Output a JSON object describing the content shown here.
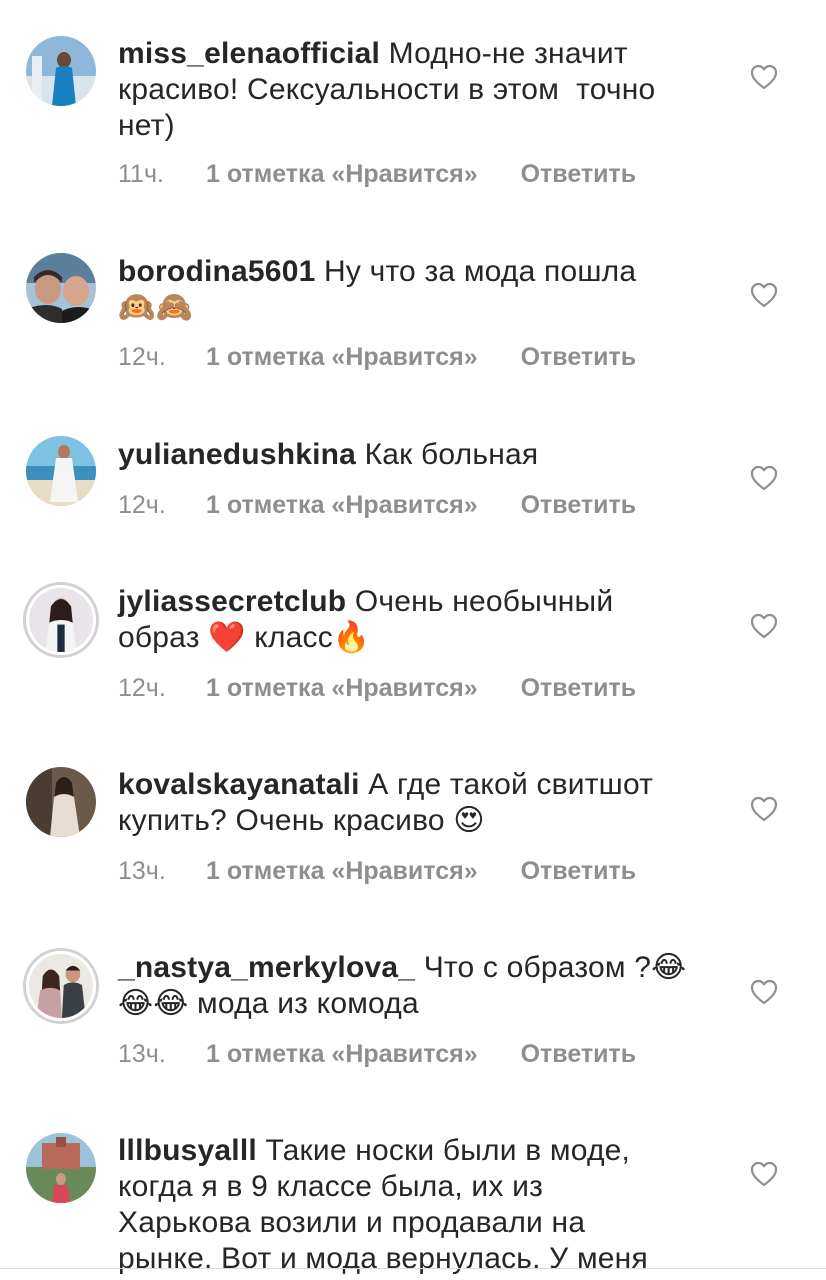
{
  "comments": [
    {
      "username": "miss_elenaofficial",
      "text": "Модно-не значит\nкрасиво! Сексуальности в этом  точно\nнет)",
      "time": "11ч.",
      "likes": "1 отметка «Нравится»",
      "reply": "Ответить"
    },
    {
      "username": "borodina5601",
      "text": "Ну что за мода пошла\n🙉🙈",
      "time": "12ч.",
      "likes": "1 отметка «Нравится»",
      "reply": "Ответить"
    },
    {
      "username": "yulianedushkina",
      "text": "Как больная",
      "time": "12ч.",
      "likes": "1 отметка «Нравится»",
      "reply": "Ответить"
    },
    {
      "username": "jyliassecretclub",
      "text": "Очень необычный\nобраз ❤️ класс🔥",
      "time": "12ч.",
      "likes": "1 отметка «Нравится»",
      "reply": "Ответить"
    },
    {
      "username": "kovalskayanatali",
      "text": "А где такой свитшот\nкупить? Очень красиво 😍",
      "time": "13ч.",
      "likes": "1 отметка «Нравится»",
      "reply": "Ответить"
    },
    {
      "username": "_nastya_merkylova_",
      "text": "Что с образом ?😂\n😂😂 мода из комода",
      "time": "13ч.",
      "likes": "1 отметка «Нравится»",
      "reply": "Ответить"
    },
    {
      "username": "lllbusyalll",
      "text": "Такие носки были в моде,\nкогда я в 9 классе была, их из\nХарькова возили и продавали на\nрынке. Вот и мода вернулась. У меня",
      "time": "",
      "likes": "",
      "reply": ""
    }
  ],
  "icons": {
    "like": "heart-outline-icon"
  },
  "colors": {
    "text": "#262626",
    "meta": "#8e8e8e"
  }
}
